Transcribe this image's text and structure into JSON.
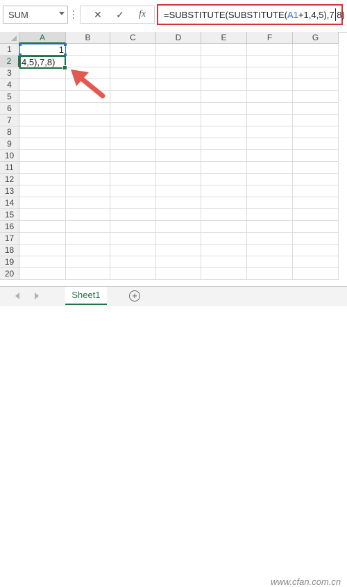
{
  "name_box": {
    "value": "SUM"
  },
  "formula_bar": {
    "cancel_icon": "✕",
    "enter_icon": "✓",
    "fx_label": "fx",
    "formula_prefix": "=SUBSTITUTE(SUBSTITUTE(",
    "formula_ref": "A1",
    "formula_suffix": "+1,4,5),7,8)"
  },
  "columns": [
    "A",
    "B",
    "C",
    "D",
    "E",
    "F",
    "G"
  ],
  "rows": [
    "1",
    "2",
    "3",
    "4",
    "5",
    "6",
    "7",
    "8",
    "9",
    "10",
    "11",
    "12",
    "13",
    "14",
    "15",
    "16",
    "17",
    "18",
    "19",
    "20"
  ],
  "cells": {
    "A1": "1",
    "A2": "4,5),7,8)"
  },
  "sheets": [
    {
      "label": "Sheet1",
      "active": true
    }
  ],
  "add_sheet_label": "+",
  "watermark": "www.cfan.com.cn",
  "colors": {
    "accent": "#217346",
    "highlight": "#d9313a",
    "arrow": "#e25a4f",
    "ref": "#2f6fd6"
  }
}
